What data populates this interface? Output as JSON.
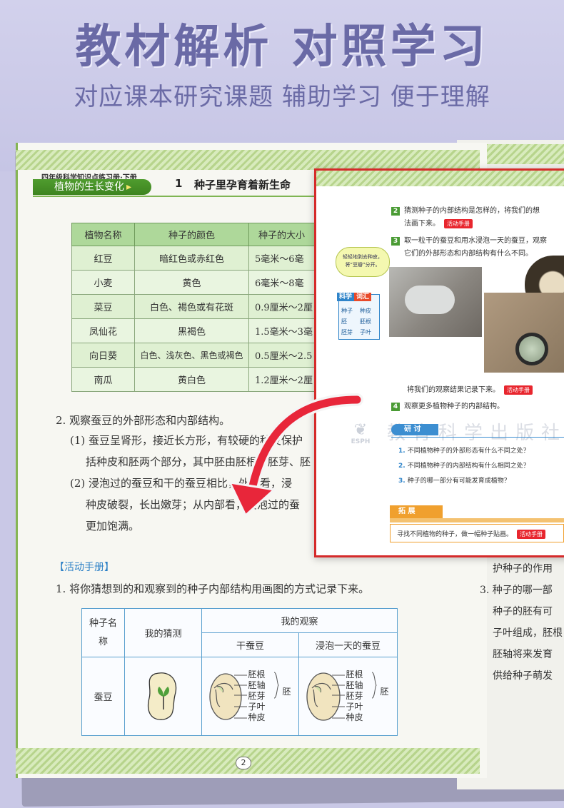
{
  "banner": {
    "headline": "教材解析 对照学习",
    "subline": "对应课本研究课题 辅助学习 便于理解"
  },
  "book": {
    "series_label": "四年级科学知识点练习册·下册",
    "chapter": "植物的生长变化",
    "lesson_number": "1",
    "lesson_title": "种子里孕育着新生命",
    "seed_table": {
      "headers": [
        "植物名称",
        "种子的颜色",
        "种子的大小"
      ],
      "rows": [
        [
          "红豆",
          "暗红色或赤红色",
          "5毫米～6毫"
        ],
        [
          "小麦",
          "黄色",
          "6毫米～8毫"
        ],
        [
          "菜豆",
          "白色、褐色或有花斑",
          "0.9厘米～2厘"
        ],
        [
          "凤仙花",
          "黑褐色",
          "1.5毫米～3毫"
        ],
        [
          "向日葵",
          "白色、浅灰色、黑色或褐色",
          "0.5厘米～2.5"
        ],
        [
          "南瓜",
          "黄白色",
          "1.2厘米～2厘"
        ]
      ]
    },
    "q2": "2. 观察蚕豆的外部形态和内部结构。",
    "p1_line1": "(1) 蚕豆呈肾形，接近长方形，有较硬的种皮保护",
    "p1_line2": "括种皮和胚两个部分，其中胚由胚根、胚芽、胚",
    "p2_line1": "(2) 浸泡过的蚕豆和干的蚕豆相比，外部看，浸",
    "p2_line2": "种皮破裂，长出嫩芽；从内部看，浸泡过的蚕",
    "p2_line3": "更加饱满。",
    "activity_heading": "【活动手册】",
    "activity_q1": "1. 将你猜想到的和观察到的种子内部结构用画图的方式记录下来。",
    "obs_table": {
      "col_seed": "种子名称",
      "col_guess": "我的猜测",
      "col_observe": "我的观察",
      "col_dry": "干蚕豆",
      "col_soaked": "浸泡一天的蚕豆",
      "row_name": "蚕豆",
      "parts": [
        "胚根",
        "胚轴",
        "胚芽",
        "子叶",
        "种皮"
      ],
      "embryo": "胚"
    },
    "page_number": "2"
  },
  "right_page": {
    "line1": "护种子的作用",
    "line2": "3. 种子的哪一部",
    "line3": "种子的胚有可",
    "line4": "子叶组成，胚根",
    "line5": "胚轴将来发育",
    "line6": "供给种子萌发"
  },
  "textbook_card": {
    "step2_num": "2",
    "step2_line1": "猜测种子的内部结构是怎样的，将我们的想",
    "step2_line2": "法画下来。",
    "step3_num": "3",
    "step3_line1": "取一粒干的蚕豆和用水浸泡一天的蚕豆，观察",
    "step3_line2": "它们的外部形态和内部结构有什么不同。",
    "bubble": "轻轻地剥去种皮，将“豆瓣”分开。",
    "vocab_a": "科学",
    "vocab_b": "词汇",
    "vocab_words": [
      "种子",
      "种皮",
      "胚",
      "胚根",
      "胚芽",
      "子叶"
    ],
    "record_line": "将我们的观察结果记录下来。",
    "step4_num": "4",
    "step4_line": "观察更多植物种子的内部结构。",
    "handbook_label": "活动手册",
    "research_label": "研 讨",
    "research_questions": [
      "不同植物种子的外部形态有什么不同之处？",
      "不同植物种子的内部结构有什么相同之处？",
      "种子的哪一部分有可能发育成植物？"
    ],
    "extend_label": "拓 展",
    "extend_text": "寻找不同植物的种子，做一幅种子贴画。",
    "publisher_logo": "ESPH",
    "watermark": "教育科学出版社"
  },
  "colors": {
    "banner_text": "#6a6aa6",
    "green": "#4f9c2e",
    "card_border": "#d52a2a",
    "arrow": "#e8263a",
    "blue": "#2f84c9",
    "orange": "#f0a02e"
  }
}
